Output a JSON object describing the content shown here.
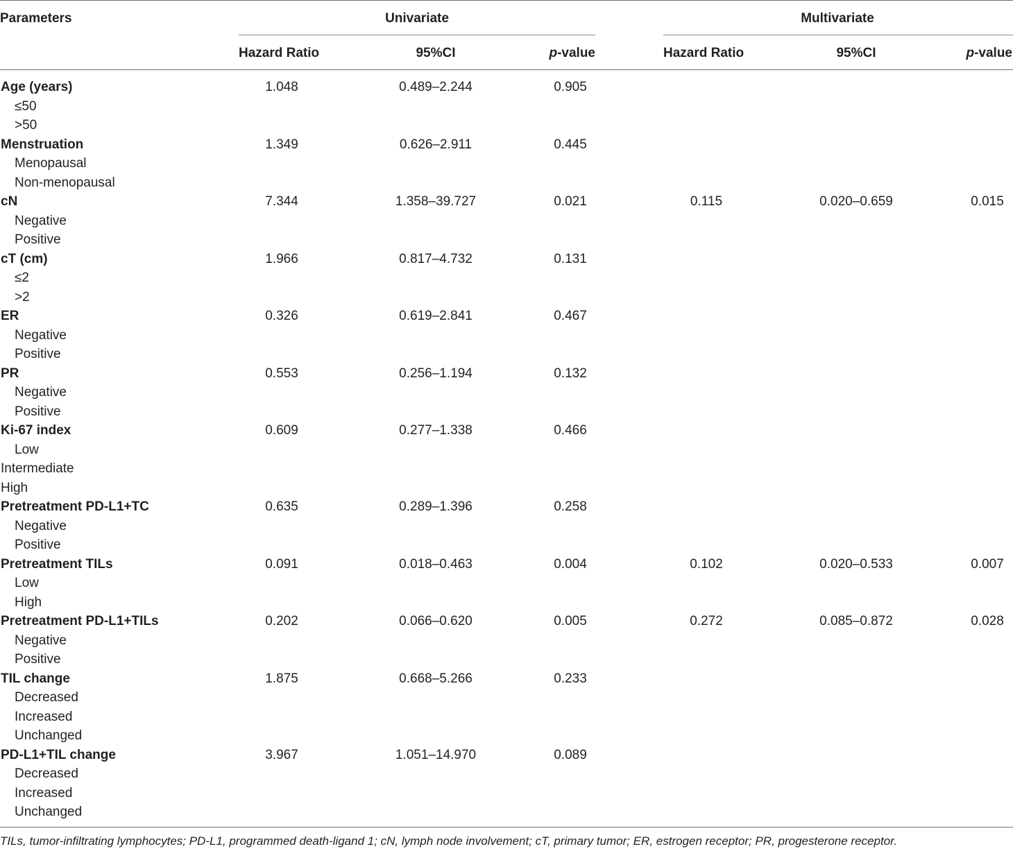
{
  "headers": {
    "parameters": "Parameters",
    "univariate": "Univariate",
    "multivariate": "Multivariate",
    "hazard_ratio": "Hazard Ratio",
    "ci": "95%CI",
    "p_value_italic": "p",
    "p_value_rest": "-value"
  },
  "rows": [
    {
      "label": "Age (years)",
      "bold": true,
      "uni": [
        "1.048",
        "0.489–2.244",
        "0.905"
      ],
      "multi": null
    },
    {
      "label": "≤50",
      "indent": true
    },
    {
      "label": ">50",
      "indent": true
    },
    {
      "label": "Menstruation",
      "bold": true,
      "uni": [
        "1.349",
        "0.626–2.911",
        "0.445"
      ],
      "multi": null
    },
    {
      "label": "Menopausal",
      "indent": true
    },
    {
      "label": "Non-menopausal",
      "indent": true
    },
    {
      "label": "cN",
      "bold": true,
      "uni": [
        "7.344",
        "1.358–39.727",
        "0.021"
      ],
      "multi": [
        "0.115",
        "0.020–0.659",
        "0.015"
      ]
    },
    {
      "label": "Negative",
      "indent": true
    },
    {
      "label": "Positive",
      "indent": true
    },
    {
      "label": "cT (cm)",
      "bold": true,
      "uni": [
        "1.966",
        "0.817–4.732",
        "0.131"
      ],
      "multi": null
    },
    {
      "label": "≤2",
      "indent": true
    },
    {
      "label": ">2",
      "indent": true
    },
    {
      "label": "ER",
      "bold": true,
      "uni": [
        "0.326",
        "0.619–2.841",
        "0.467"
      ],
      "multi": null
    },
    {
      "label": "Negative",
      "indent": true
    },
    {
      "label": "Positive",
      "indent": true
    },
    {
      "label": "PR",
      "bold": true,
      "uni": [
        "0.553",
        "0.256–1.194",
        "0.132"
      ],
      "multi": null
    },
    {
      "label": "Negative",
      "indent": true
    },
    {
      "label": "Positive",
      "indent": true
    },
    {
      "label": "Ki-67 index",
      "bold": true,
      "uni": [
        "0.609",
        "0.277–1.338",
        "0.466"
      ],
      "multi": null
    },
    {
      "label": "Low",
      "indent": true
    },
    {
      "label": "Intermediate",
      "indent": false
    },
    {
      "label": "High",
      "indent": false
    },
    {
      "label": "Pretreatment PD-L1+TC",
      "bold": true,
      "uni": [
        "0.635",
        "0.289–1.396",
        "0.258"
      ],
      "multi": null
    },
    {
      "label": "Negative",
      "indent": true
    },
    {
      "label": "Positive",
      "indent": true
    },
    {
      "label": "Pretreatment TILs",
      "bold": true,
      "uni": [
        "0.091",
        "0.018–0.463",
        "0.004"
      ],
      "multi": [
        "0.102",
        "0.020–0.533",
        "0.007"
      ]
    },
    {
      "label": "Low",
      "indent": true
    },
    {
      "label": "High",
      "indent": true
    },
    {
      "label": "Pretreatment PD-L1+TILs",
      "bold": true,
      "uni": [
        "0.202",
        "0.066–0.620",
        "0.005"
      ],
      "multi": [
        "0.272",
        "0.085–0.872",
        "0.028"
      ]
    },
    {
      "label": "Negative",
      "indent": true
    },
    {
      "label": "Positive",
      "indent": true
    },
    {
      "label": "TIL change",
      "bold": true,
      "uni": [
        "1.875",
        "0.668–5.266",
        "0.233"
      ],
      "multi": null
    },
    {
      "label": "Decreased",
      "indent": true
    },
    {
      "label": "Increased",
      "indent": true
    },
    {
      "label": "Unchanged",
      "indent": true
    },
    {
      "label": "PD-L1+TIL change",
      "bold": true,
      "uni": [
        "3.967",
        "1.051–14.970",
        "0.089"
      ],
      "multi": null
    },
    {
      "label": "Decreased",
      "indent": true
    },
    {
      "label": "Increased",
      "indent": true
    },
    {
      "label": "Unchanged",
      "indent": true
    }
  ],
  "footnote": "TILs, tumor-infiltrating lymphocytes; PD-L1, programmed death-ligand 1; cN, lymph node involvement; cT, primary tumor; ER, estrogen receptor; PR, progesterone receptor."
}
